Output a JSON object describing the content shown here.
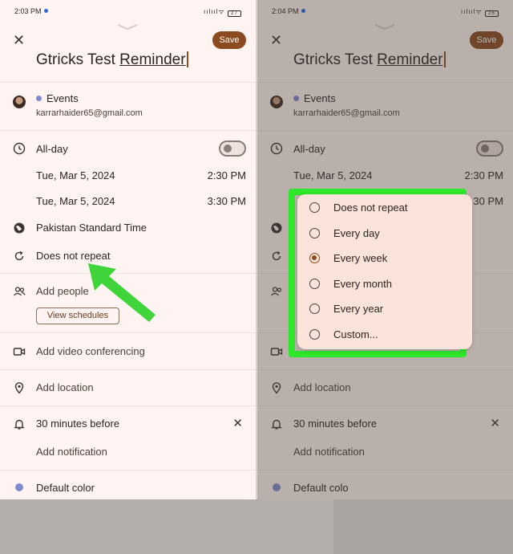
{
  "left": {
    "status": {
      "time": "2:03 PM",
      "battery": "27"
    },
    "header": {
      "close_icon": "close-icon",
      "save_label": "Save",
      "title_plain": "Gtricks Test ",
      "title_underlined": "Reminder"
    },
    "calendar": {
      "name": "Events",
      "email": "karrarhaider65@gmail.com",
      "color": "#7e8bd0"
    },
    "all_day_label": "All-day",
    "start": {
      "date": "Tue, Mar 5, 2024",
      "time": "2:30 PM"
    },
    "end": {
      "date": "Tue, Mar 5, 2024",
      "time": "3:30 PM"
    },
    "timezone": "Pakistan Standard Time",
    "repeat": "Does not repeat",
    "people": {
      "label": "Add people",
      "view_schedules": "View schedules"
    },
    "video": "Add video conferencing",
    "location": "Add location",
    "notification": {
      "value": "30 minutes before",
      "add": "Add notification"
    },
    "color_label": "Default color"
  },
  "right": {
    "status": {
      "time": "2:04 PM",
      "battery": "26"
    },
    "header": {
      "save_label": "Save",
      "title_plain": "Gtricks Test ",
      "title_underlined": "Reminder"
    },
    "calendar": {
      "name": "Events",
      "email": "karrarhaider65@gmail.com"
    },
    "all_day_label": "All-day",
    "start": {
      "date": "Tue, Mar 5, 2024",
      "time": "2:30 PM"
    },
    "end_time_partial": "30 PM",
    "location": "Add location",
    "notification": {
      "value": "30 minutes before",
      "add": "Add notification"
    },
    "color_label_partial": "Default colo",
    "repeat_menu": {
      "selected": "Every week",
      "options": [
        "Does not repeat",
        "Every day",
        "Every week",
        "Every month",
        "Every year",
        "Custom..."
      ]
    }
  },
  "colors": {
    "accent": "#8b4a1f",
    "highlight_frame": "#2ee62a",
    "arrow": "#3fd43a",
    "popup_bg": "#fae3d8"
  }
}
